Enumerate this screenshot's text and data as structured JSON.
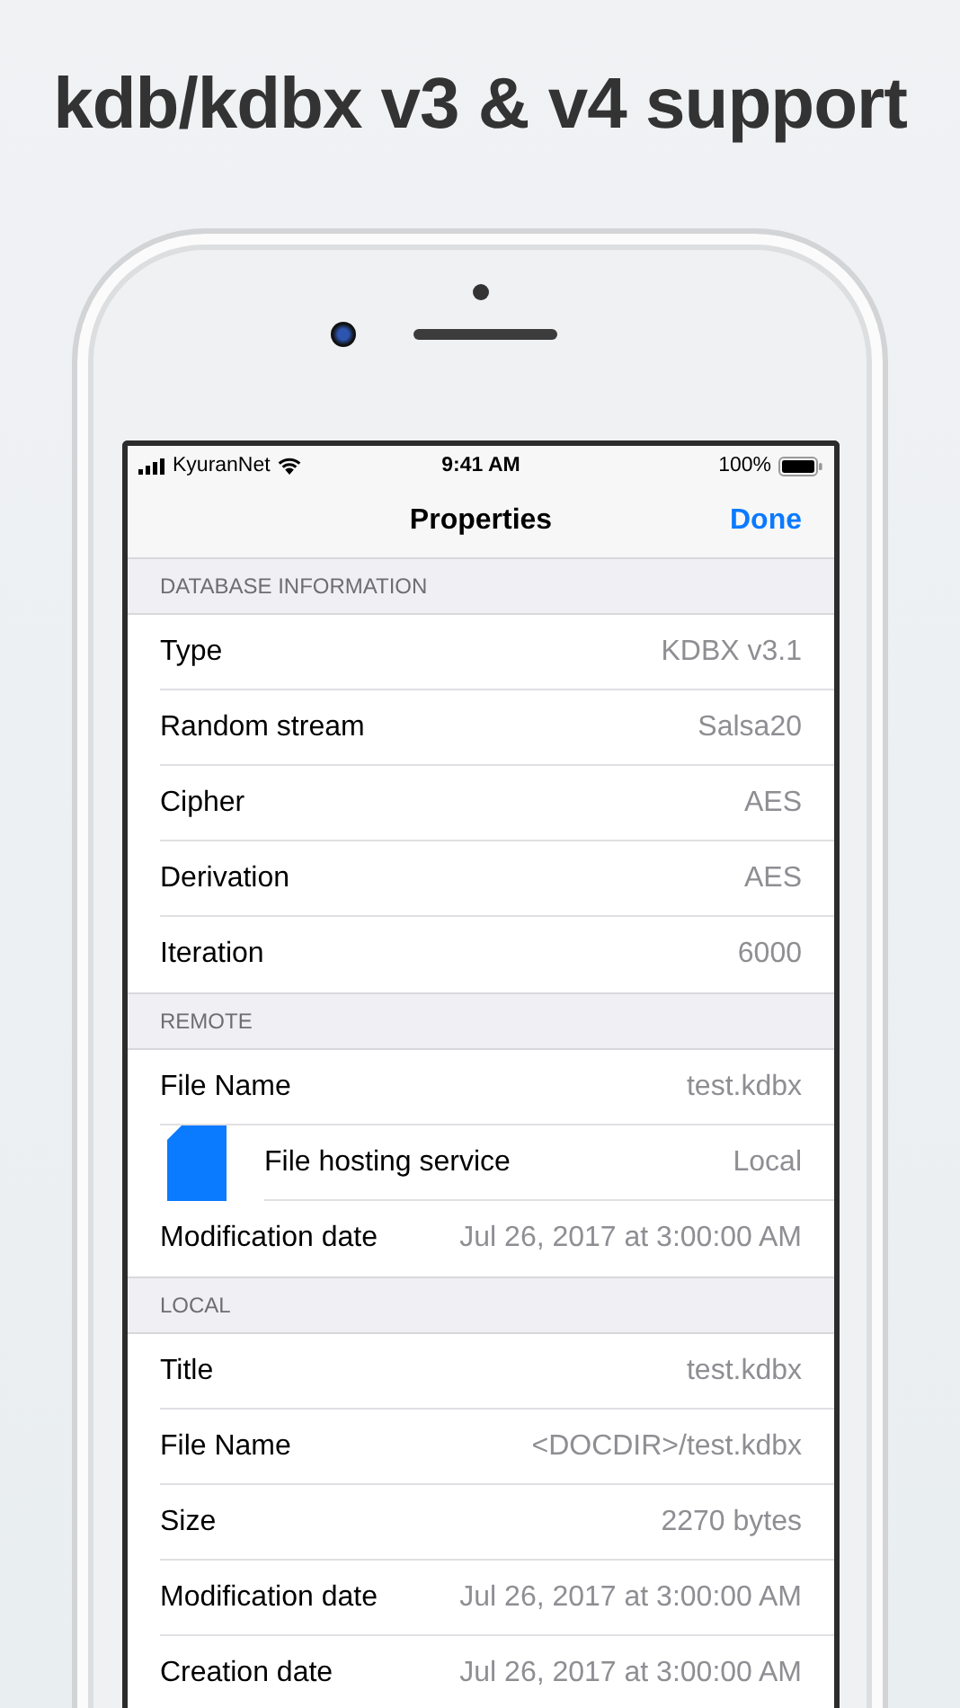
{
  "headline": "kdb/kdbx v3 & v4 support",
  "status_bar": {
    "carrier": "KyuranNet",
    "time": "9:41 AM",
    "battery": "100%"
  },
  "nav": {
    "title": "Properties",
    "action": "Done"
  },
  "sections": [
    {
      "header": "DATABASE INFORMATION",
      "rows": [
        {
          "kind": "row",
          "label": "Type",
          "value": "KDBX v3.1"
        },
        {
          "kind": "row",
          "label": "Random stream",
          "value": "Salsa20"
        },
        {
          "kind": "row",
          "label": "Cipher",
          "value": "AES"
        },
        {
          "kind": "row",
          "label": "Derivation",
          "value": "AES"
        },
        {
          "kind": "row",
          "label": "Iteration",
          "value": "6000"
        }
      ]
    },
    {
      "header": "REMOTE",
      "rows": [
        {
          "kind": "row",
          "label": "File Name",
          "value": "test.kdbx"
        },
        {
          "kind": "service",
          "label": "File hosting service",
          "value": "Local"
        },
        {
          "kind": "row",
          "label": "Modification date",
          "value": "Jul 26, 2017 at 3:00:00 AM"
        }
      ]
    },
    {
      "header": "LOCAL",
      "rows": [
        {
          "kind": "row",
          "label": "Title",
          "value": "test.kdbx"
        },
        {
          "kind": "row",
          "label": "File Name",
          "value": "<DOCDIR>/test.kdbx"
        },
        {
          "kind": "row",
          "label": "Size",
          "value": "2270 bytes"
        },
        {
          "kind": "row",
          "label": "Modification date",
          "value": "Jul 26, 2017 at 3:00:00 AM"
        },
        {
          "kind": "row",
          "label": "Creation date",
          "value": "Jul 26, 2017 at 3:00:00 AM"
        }
      ]
    }
  ]
}
